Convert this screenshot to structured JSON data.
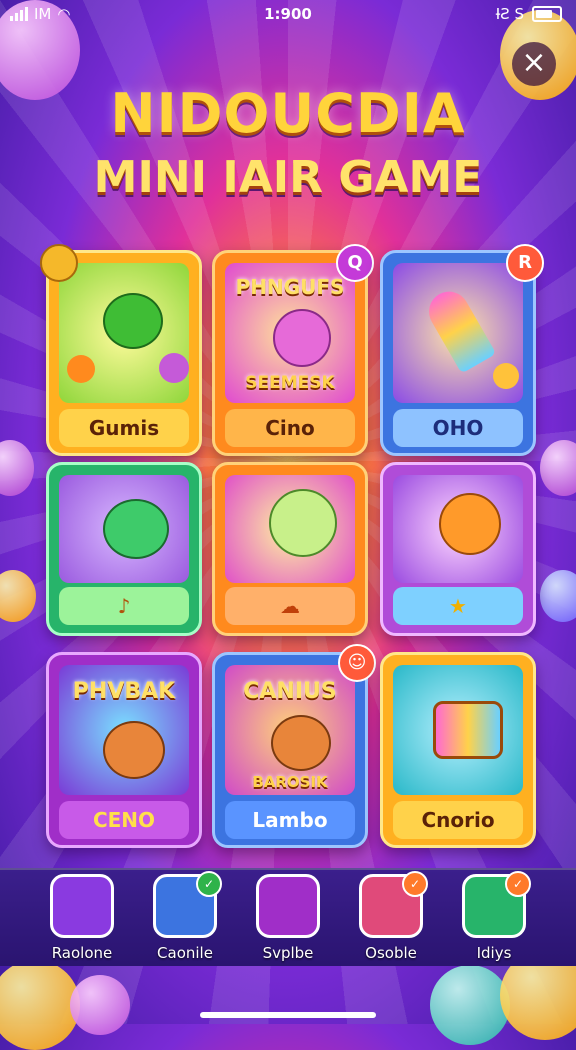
{
  "status": {
    "time": "1:900",
    "left_text": "IM",
    "right_text": "ƗƧ S"
  },
  "title": {
    "line1": "NIDOUCDIA",
    "line2": "MINI IAIR GAME"
  },
  "cards": [
    {
      "label": "Gumis",
      "art_title": "",
      "art_subtitle": "",
      "badge": ""
    },
    {
      "label": "Cino",
      "art_title": "PHNGUFS",
      "art_subtitle": "SEEMESK",
      "badge": "Q"
    },
    {
      "label": "OHO",
      "art_title": "",
      "art_subtitle": "",
      "badge": "R"
    },
    {
      "label": "♪",
      "art_title": "",
      "art_subtitle": "",
      "badge": ""
    },
    {
      "label": "☁",
      "art_title": "",
      "art_subtitle": "",
      "badge": ""
    },
    {
      "label": "★",
      "art_title": "",
      "art_subtitle": "",
      "badge": ""
    },
    {
      "label": "CENO",
      "art_title": "PHVBAK",
      "art_subtitle": "",
      "badge": ""
    },
    {
      "label": "Lambo",
      "art_title": "CANIUS",
      "art_subtitle": "BAROSIK",
      "badge": "☺"
    },
    {
      "label": "Cnorio",
      "art_title": "",
      "art_subtitle": "",
      "badge": ""
    }
  ],
  "dock": [
    {
      "label": "Raolone"
    },
    {
      "label": "Caonile",
      "badge": "✓"
    },
    {
      "label": "Svplbe"
    },
    {
      "label": "Osoble",
      "badge": "✓"
    },
    {
      "label": "Idiys",
      "badge": "✓"
    }
  ],
  "colors": {
    "accent": "#ffd43b",
    "plate_orange": "#ffb020",
    "plate_blue": "#4a8df0",
    "plate_purple": "#b04cd8"
  }
}
